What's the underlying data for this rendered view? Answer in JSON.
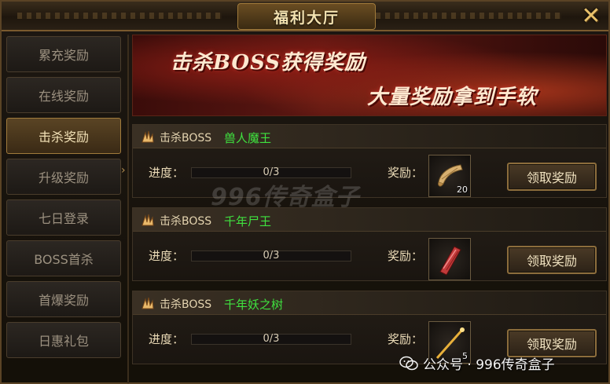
{
  "window": {
    "title": "福利大厅",
    "close_label": "✕"
  },
  "sidebar": {
    "items": [
      {
        "label": "累充奖励"
      },
      {
        "label": "在线奖励"
      },
      {
        "label": "击杀奖励",
        "active": true
      },
      {
        "label": "升级奖励"
      },
      {
        "label": "七日登录"
      },
      {
        "label": "BOSS首杀"
      },
      {
        "label": "首爆奖励"
      },
      {
        "label": "日惠礼包"
      }
    ]
  },
  "banner": {
    "line1": "击杀BOSS获得奖励",
    "line2": "大量奖励拿到手软"
  },
  "cards": [
    {
      "boss_label": "击杀BOSS",
      "boss_name": "兽人魔王",
      "progress_label": "进度：",
      "progress_text": "0/3",
      "progress_fraction": 0.0,
      "reward_label": "奖励：",
      "item_icon": "scroll-icon",
      "item_count": "20",
      "claim_label": "领取奖励"
    },
    {
      "boss_label": "击杀BOSS",
      "boss_name": "千年尸王",
      "progress_label": "进度：",
      "progress_text": "0/3",
      "progress_fraction": 0.0,
      "reward_label": "奖励：",
      "item_icon": "red-talisman-icon",
      "item_count": "",
      "claim_label": "领取奖励"
    },
    {
      "boss_label": "击杀BOSS",
      "boss_name": "千年妖之树",
      "progress_label": "进度：",
      "progress_text": "0/3",
      "progress_fraction": 0.0,
      "reward_label": "奖励：",
      "item_icon": "golden-staff-icon",
      "item_count": "5",
      "claim_label": "领取奖励"
    }
  ],
  "watermark": "996传奇盒子",
  "footer": {
    "wechat_text": "公众号 · 996传奇盒子"
  }
}
